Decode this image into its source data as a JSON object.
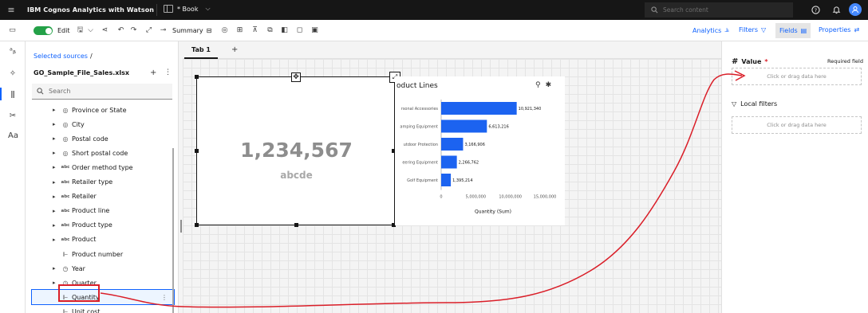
{
  "header": {
    "app_title": "IBM Cognos Analytics with Watson",
    "book_title": "* Book",
    "search_placeholder": "Search content"
  },
  "toolbar": {
    "edit_label": "Edit",
    "summary_label": "Summary",
    "right": {
      "analytics": "Analytics",
      "filters": "Filters",
      "fields": "Fields",
      "properties": "Properties"
    }
  },
  "sources": {
    "breadcrumb": "Selected sources",
    "breadcrumb_sep": "/",
    "file_name": "GO_Sample_File_Sales.xlsx",
    "search_placeholder": "Search",
    "items": [
      {
        "label": "Province or State",
        "icon": "location-icon",
        "glyph": "◎",
        "expandable": true
      },
      {
        "label": "City",
        "icon": "location-icon",
        "glyph": "◎",
        "expandable": true
      },
      {
        "label": "Postal code",
        "icon": "location-icon",
        "glyph": "◎",
        "expandable": true
      },
      {
        "label": "Short postal code",
        "icon": "location-icon",
        "glyph": "◎",
        "expandable": true
      },
      {
        "label": "Order method type",
        "icon": "text-icon",
        "glyph": "abc",
        "expandable": true
      },
      {
        "label": "Retailer type",
        "icon": "text-icon",
        "glyph": "abc",
        "expandable": true
      },
      {
        "label": "Retailer",
        "icon": "text-icon",
        "glyph": "abc",
        "expandable": true
      },
      {
        "label": "Product line",
        "icon": "text-icon",
        "glyph": "abc",
        "expandable": true
      },
      {
        "label": "Product type",
        "icon": "text-icon",
        "glyph": "abc",
        "expandable": true
      },
      {
        "label": "Product",
        "icon": "text-icon",
        "glyph": "abc",
        "expandable": true
      },
      {
        "label": "Product number",
        "icon": "measure-icon",
        "glyph": "⊩",
        "expandable": false
      },
      {
        "label": "Year",
        "icon": "clock-icon",
        "glyph": "◷",
        "expandable": true
      },
      {
        "label": "Quarter",
        "icon": "clock-icon",
        "glyph": "◷",
        "expandable": true
      },
      {
        "label": "Quantity",
        "icon": "measure-icon",
        "glyph": "⊩",
        "expandable": false,
        "selected": true
      },
      {
        "label": "Unit cost",
        "icon": "measure-icon",
        "glyph": "⊩",
        "expandable": false
      }
    ]
  },
  "canvas": {
    "tab_label": "Tab 1",
    "add_tab": "+",
    "kpi": {
      "value": "1,234,567",
      "subtitle": "abcde"
    },
    "chart_title": "oduct Lines"
  },
  "chart_data": {
    "type": "bar",
    "orientation": "horizontal",
    "title": "oduct Lines",
    "categories": [
      "rsonal Accessories",
      "amping Equipment",
      "utdoor Protection",
      "eering Equipment",
      "Golf Equipment"
    ],
    "values": [
      10921340,
      6613216,
      3166906,
      2266762,
      1395214
    ],
    "value_labels": [
      "10,921,340",
      "6,613,216",
      "3,166,906",
      "2,266,762",
      "1,395,214"
    ],
    "xlabel": "Quantity (Sum)",
    "xticks": [
      0,
      5000000,
      10000000,
      15000000
    ],
    "xtick_labels": [
      "0",
      "5,000,000",
      "10,000,000",
      "15,000,000"
    ],
    "xlim": [
      0,
      15000000
    ],
    "bar_color": "#1c63f0"
  },
  "fields_panel": {
    "value_label": "Value",
    "required_star": "*",
    "required_text": "Required field",
    "dropzone_text": "Click or drag data here",
    "local_filters": "Local filters",
    "filter_dropzone_text": "Click or drag data here"
  },
  "colors": {
    "accent": "#0f62fe",
    "header_bg": "#161616",
    "annotation_red": "#da1e28",
    "toggle_green": "#24a148"
  }
}
